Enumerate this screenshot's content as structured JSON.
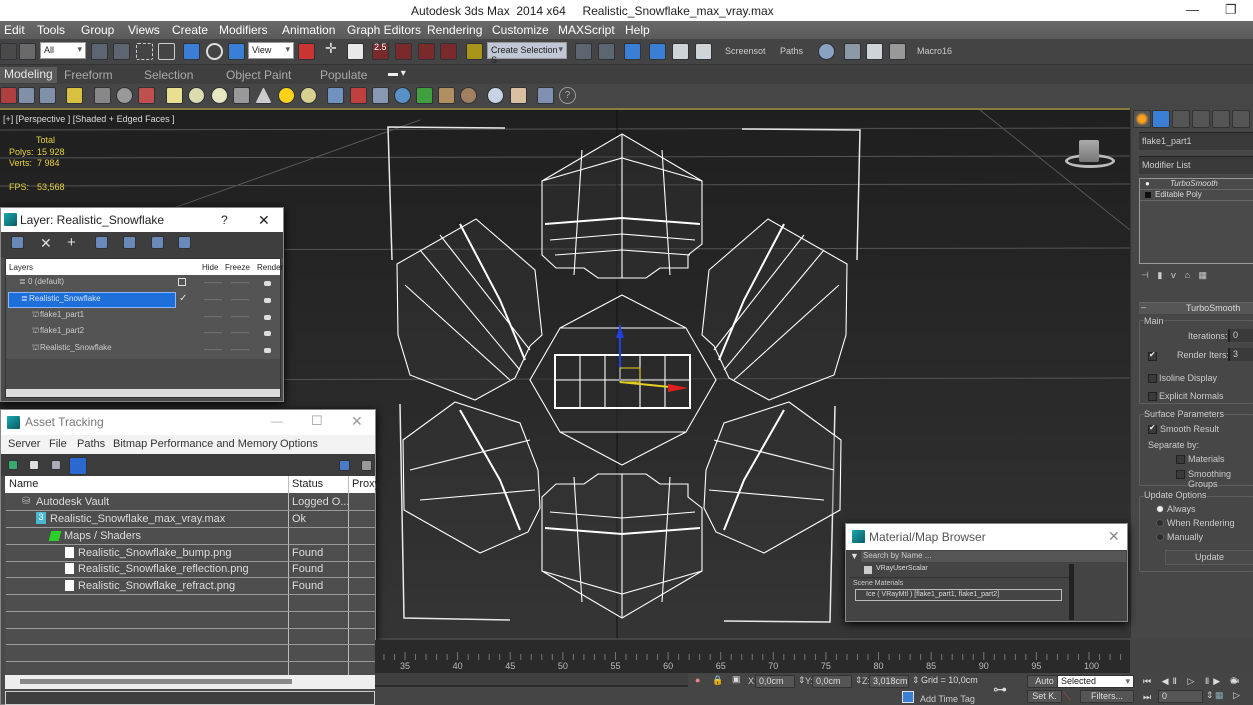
{
  "window": {
    "app_title": "Autodesk 3ds Max  2014 x64",
    "file_title": "Realistic_Snowflake_max_vray.max",
    "minimize_label": "—",
    "restore_label": "❐"
  },
  "menu": [
    "Edit",
    "Tools",
    "Group",
    "Views",
    "Create",
    "Modifiers",
    "Animation",
    "Graph Editors",
    "Rendering",
    "Customize",
    "MAXScript",
    "Help"
  ],
  "toolbar": {
    "selection_filter": "All",
    "ref_coord": "View",
    "named_selection": "Create Selection S",
    "snap_angle_label": "2.5",
    "screenshot_label": "Screensot",
    "paths_label": "Paths",
    "macro_label": "Macro16"
  },
  "ribbon": {
    "tabs": [
      "Modeling",
      "Freeform",
      "Selection",
      "Object Paint",
      "Populate"
    ],
    "active_tab": 0
  },
  "viewport": {
    "label": "[+] [Perspective ] [Shaded + Edged Faces ]",
    "stats": {
      "total_label": "Total",
      "polys_label": "Polys:",
      "polys_value": "15 928",
      "verts_label": "Verts:",
      "verts_value": "7 984",
      "fps_label": "FPS:",
      "fps_value": "53,568"
    },
    "colors": {
      "stats_text": "#e6d23c",
      "wire": "#ffffff",
      "axis_x": "#e02020",
      "axis_y": "#e8d020",
      "axis_z": "#2040e0"
    }
  },
  "layer_dialog": {
    "title": "Layer: Realistic_Snowflake",
    "help_label": "?",
    "close_label": "✕",
    "columns": [
      "Layers",
      "Hide",
      "Freeze",
      "Render"
    ],
    "rows": [
      {
        "name": "0 (default)",
        "level": 0,
        "type": "layer",
        "selected": false,
        "current": "box"
      },
      {
        "name": "Realistic_Snowflake",
        "level": 0,
        "type": "layer",
        "selected": true,
        "current": "check"
      },
      {
        "name": "flake1_part1",
        "level": 1,
        "type": "object",
        "selected": false,
        "current": ""
      },
      {
        "name": "flake1_part2",
        "level": 1,
        "type": "object",
        "selected": false,
        "current": ""
      },
      {
        "name": "Realistic_Snowflake",
        "level": 1,
        "type": "object",
        "selected": false,
        "current": ""
      }
    ],
    "dash": "——"
  },
  "asset_dialog": {
    "title": "Asset Tracking",
    "menu": [
      "Server",
      "File",
      "Paths",
      "Bitmap Performance and Memory",
      "Options"
    ],
    "columns": [
      "Name",
      "Status",
      "Proxy"
    ],
    "rows": [
      {
        "name": "Autodesk Vault",
        "status": "Logged O...",
        "level": 1,
        "icon": "vault-icon"
      },
      {
        "name": "Realistic_Snowflake_max_vray.max",
        "status": "Ok",
        "level": 2,
        "icon": "max-file-icon"
      },
      {
        "name": "Maps / Shaders",
        "status": "",
        "level": 3,
        "icon": "maps-folder-icon"
      },
      {
        "name": "Realistic_Snowflake_bump.png",
        "status": "Found",
        "level": 4,
        "icon": "bitmap-icon"
      },
      {
        "name": "Realistic_Snowflake_reflection.png",
        "status": "Found",
        "level": 4,
        "icon": "bitmap-icon"
      },
      {
        "name": "Realistic_Snowflake_refract.png",
        "status": "Found",
        "level": 4,
        "icon": "bitmap-icon"
      }
    ],
    "empty_rows": 5
  },
  "material_browser": {
    "title": "Material/Map Browser",
    "search_placeholder": "Search by Name ...",
    "item_vray_user_scalar": "VRayUserScalar",
    "section_scene_materials": "Scene Materials",
    "scene_material": "Ice ( VRayMtl ) [flake1_part1, flake1_part2]",
    "close_label": "✕"
  },
  "command_panel": {
    "object_name": "flake1_part1",
    "modifier_list_label": "Modifier List",
    "stack": [
      "TurboSmooth",
      "Editable Poly"
    ],
    "rollout_title": "TurboSmooth",
    "main_group": "Main",
    "iterations_label": "Iterations:",
    "iterations_value": "0",
    "render_iters_label": "Render Iters:",
    "render_iters_value": "3",
    "render_iters_checked": true,
    "isoline_label": "Isoline Display",
    "isoline_checked": false,
    "explicit_normals_label": "Explicit Normals",
    "explicit_normals_checked": false,
    "surface_group": "Surface Parameters",
    "smooth_result_label": "Smooth Result",
    "smooth_result_checked": true,
    "separate_by_label": "Separate by:",
    "materials_label": "Materials",
    "smoothing_groups_label": "Smoothing Groups",
    "update_group": "Update Options",
    "update_options": [
      "Always",
      "When Rendering",
      "Manually"
    ],
    "update_selected": 0,
    "update_button": "Update"
  },
  "timeline": {
    "ticks": [
      "35",
      "40",
      "45",
      "50",
      "55",
      "60",
      "65",
      "70",
      "75",
      "80",
      "85",
      "90",
      "95",
      "100"
    ]
  },
  "status": {
    "x_label": "X:",
    "x_value": "0,0cm",
    "y_label": "Y:",
    "y_value": "0,0cm",
    "z_label": "Z:",
    "z_value": "3,018cm",
    "grid": "Grid = 10,0cm",
    "add_time_tag": "Add Time Tag",
    "auto_key": "Auto",
    "set_key": "Set K.",
    "key_filter_selected": "Selected",
    "filters_label": "Filters...",
    "current_frame": "0"
  }
}
